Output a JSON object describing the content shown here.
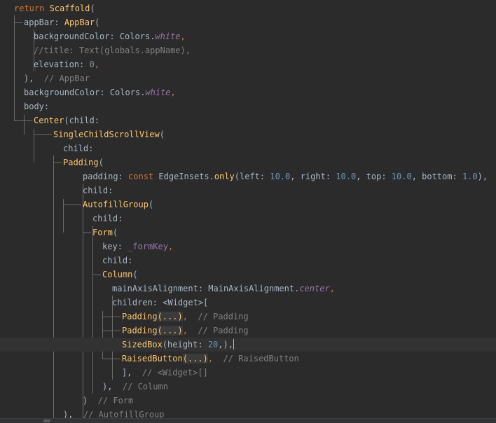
{
  "editor": {
    "lines": [
      {
        "indent": 20,
        "tokens": [
          {
            "t": "return ",
            "c": "kw"
          },
          {
            "t": "Scaffold",
            "c": "cls"
          },
          {
            "t": "(",
            "c": "punc"
          }
        ]
      },
      {
        "indent": 34,
        "tokens": [
          {
            "t": "appBar",
            "c": "id"
          },
          {
            "t": ": ",
            "c": "punc"
          },
          {
            "t": "AppBar",
            "c": "cls"
          },
          {
            "t": "(",
            "c": "punc"
          }
        ]
      },
      {
        "indent": 48,
        "tokens": [
          {
            "t": "backgroundColor",
            "c": "id"
          },
          {
            "t": ": Colors.",
            "c": "punc"
          },
          {
            "t": "white",
            "c": "const"
          },
          {
            "t": ",",
            "c": "kw"
          }
        ]
      },
      {
        "indent": 48,
        "tokens": [
          {
            "t": "//title: Text(globals.appName),",
            "c": "com"
          }
        ]
      },
      {
        "indent": 48,
        "tokens": [
          {
            "t": "elevation",
            "c": "id"
          },
          {
            "t": ": ",
            "c": "punc"
          },
          {
            "t": "0",
            "c": "num"
          },
          {
            "t": ",",
            "c": "kw"
          }
        ]
      },
      {
        "indent": 34,
        "tokens": [
          {
            "t": "),",
            "c": "punc"
          },
          {
            "t": "  // AppBar",
            "c": "com"
          }
        ]
      },
      {
        "indent": 34,
        "tokens": [
          {
            "t": "backgroundColor",
            "c": "id"
          },
          {
            "t": ": Colors.",
            "c": "punc"
          },
          {
            "t": "white",
            "c": "const"
          },
          {
            "t": ",",
            "c": "kw"
          }
        ]
      },
      {
        "indent": 34,
        "tokens": [
          {
            "t": "body",
            "c": "id"
          },
          {
            "t": ":",
            "c": "punc"
          }
        ]
      },
      {
        "indent": 48,
        "tokens": [
          {
            "t": "Center",
            "c": "cls"
          },
          {
            "t": "(child:",
            "c": "punc"
          }
        ]
      },
      {
        "indent": 76,
        "tokens": [
          {
            "t": "SingleChildScrollView",
            "c": "cls"
          },
          {
            "t": "(",
            "c": "punc"
          }
        ]
      },
      {
        "indent": 90,
        "tokens": [
          {
            "t": "child",
            "c": "id"
          },
          {
            "t": ":",
            "c": "punc"
          }
        ]
      },
      {
        "indent": 90,
        "tokens": [
          {
            "t": "Padding",
            "c": "cls"
          },
          {
            "t": "(",
            "c": "punc"
          }
        ]
      },
      {
        "indent": 118,
        "tokens": [
          {
            "t": "padding",
            "c": "id"
          },
          {
            "t": ": ",
            "c": "punc"
          },
          {
            "t": "const ",
            "c": "kw"
          },
          {
            "t": "EdgeInsets",
            "c": "ty"
          },
          {
            "t": ".",
            "c": "punc"
          },
          {
            "t": "only",
            "c": "fn"
          },
          {
            "t": "(left: ",
            "c": "punc"
          },
          {
            "t": "10.0",
            "c": "num"
          },
          {
            "t": ", right: ",
            "c": "punc"
          },
          {
            "t": "10.0",
            "c": "num"
          },
          {
            "t": ", top: ",
            "c": "punc"
          },
          {
            "t": "10.0",
            "c": "num"
          },
          {
            "t": ", bottom: ",
            "c": "punc"
          },
          {
            "t": "1.0",
            "c": "num"
          },
          {
            "t": "),",
            "c": "punc"
          }
        ]
      },
      {
        "indent": 118,
        "tokens": [
          {
            "t": "child",
            "c": "id"
          },
          {
            "t": ":",
            "c": "punc"
          }
        ]
      },
      {
        "indent": 118,
        "tokens": [
          {
            "t": "AutofillGroup",
            "c": "cls"
          },
          {
            "t": "(",
            "c": "punc"
          }
        ]
      },
      {
        "indent": 132,
        "tokens": [
          {
            "t": "child",
            "c": "id"
          },
          {
            "t": ":",
            "c": "punc"
          }
        ]
      },
      {
        "indent": 132,
        "tokens": [
          {
            "t": "Form",
            "c": "cls"
          },
          {
            "t": "(",
            "c": "punc"
          }
        ]
      },
      {
        "indent": 146,
        "tokens": [
          {
            "t": "key",
            "c": "id"
          },
          {
            "t": ": ",
            "c": "punc"
          },
          {
            "t": "_formKey",
            "c": "priv"
          },
          {
            "t": ",",
            "c": "kw"
          }
        ]
      },
      {
        "indent": 146,
        "tokens": [
          {
            "t": "child",
            "c": "id"
          },
          {
            "t": ":",
            "c": "punc"
          }
        ]
      },
      {
        "indent": 146,
        "tokens": [
          {
            "t": "Column",
            "c": "cls"
          },
          {
            "t": "(",
            "c": "punc"
          }
        ]
      },
      {
        "indent": 160,
        "tokens": [
          {
            "t": "mainAxisAlignment",
            "c": "id"
          },
          {
            "t": ": MainAxisAlignment.",
            "c": "punc"
          },
          {
            "t": "center",
            "c": "const"
          },
          {
            "t": ",",
            "c": "kw"
          }
        ]
      },
      {
        "indent": 160,
        "tokens": [
          {
            "t": "children",
            "c": "id"
          },
          {
            "t": ": <Widget>[",
            "c": "punc"
          }
        ]
      },
      {
        "indent": 174,
        "tokens": [
          {
            "t": "Padding",
            "c": "cls"
          },
          {
            "t": "(...)",
            "c": "fold-y"
          },
          {
            "t": ",",
            "c": "kw"
          },
          {
            "t": "  // Padding",
            "c": "com"
          }
        ]
      },
      {
        "indent": 174,
        "tokens": [
          {
            "t": "Padding",
            "c": "cls"
          },
          {
            "t": "(...)",
            "c": "fold-y"
          },
          {
            "t": ",",
            "c": "kw"
          },
          {
            "t": "  // Padding",
            "c": "com"
          }
        ]
      },
      {
        "indent": 174,
        "caret": true,
        "tokens": [
          {
            "t": "SizedBox",
            "c": "cls"
          },
          {
            "t": "(height: ",
            "c": "punc"
          },
          {
            "t": "20",
            "c": "num"
          },
          {
            "t": ",),",
            "c": "punc"
          }
        ]
      },
      {
        "indent": 174,
        "tokens": [
          {
            "t": "RaisedButton",
            "c": "cls"
          },
          {
            "t": "(...)",
            "c": "fold-y"
          },
          {
            "t": ",",
            "c": "kw"
          },
          {
            "t": "  // RaisedButton",
            "c": "com"
          }
        ]
      },
      {
        "indent": 174,
        "tokens": [
          {
            "t": "],",
            "c": "punc"
          },
          {
            "t": "  // <Widget>[]",
            "c": "com"
          }
        ]
      },
      {
        "indent": 146,
        "tokens": [
          {
            "t": "),",
            "c": "punc"
          },
          {
            "t": "  // Column",
            "c": "com"
          }
        ]
      },
      {
        "indent": 118,
        "tokens": [
          {
            "t": ")",
            "c": "punc"
          },
          {
            "t": "  // Form",
            "c": "com"
          }
        ]
      },
      {
        "indent": 90,
        "tokens": [
          {
            "t": "),",
            "c": "punc"
          },
          {
            "t": "  // AutofillGroup",
            "c": "com"
          }
        ]
      }
    ]
  },
  "colors": {
    "background": "#2b2b2b",
    "guide": "#6b6b6b",
    "caret_line": "#323232"
  }
}
